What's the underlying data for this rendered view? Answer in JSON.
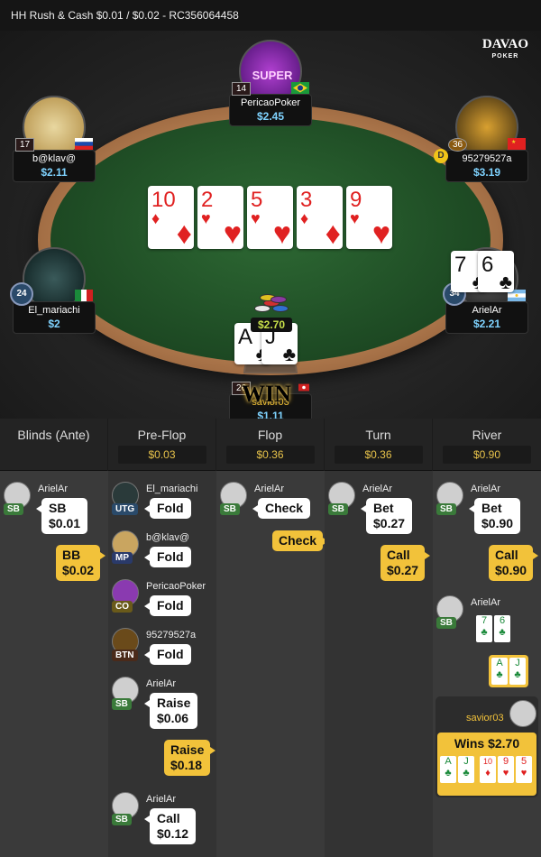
{
  "header": {
    "title": "HH  Rush & Cash $0.01 / $0.02  - RC356064458"
  },
  "logo": {
    "text": "DAVAO",
    "sub": "POKER"
  },
  "players": {
    "top": {
      "name": "PericaoPoker",
      "stack": "$2.45",
      "level": "14"
    },
    "top_left": {
      "name": "b@klav@",
      "stack": "$2.11",
      "level": "17"
    },
    "top_right": {
      "name": "95279527a",
      "stack": "$3.19",
      "level": "36",
      "dealer": "D"
    },
    "left": {
      "name": "El_mariachi",
      "stack": "$2",
      "level": "24"
    },
    "right": {
      "name": "ArielAr",
      "stack": "$2.21",
      "level": "34"
    },
    "bottom": {
      "name": "savior03",
      "stack": "$1.11",
      "level": "26"
    }
  },
  "board": [
    {
      "rank": "10",
      "suit": "♦"
    },
    {
      "rank": "2",
      "suit": "♥"
    },
    {
      "rank": "5",
      "suit": "♥"
    },
    {
      "rank": "3",
      "suit": "♦"
    },
    {
      "rank": "9",
      "suit": "♥"
    }
  ],
  "right_hole": [
    {
      "rank": "7",
      "suit": "♣"
    },
    {
      "rank": "6",
      "suit": "♣"
    }
  ],
  "bottom_hole": [
    {
      "rank": "A",
      "suit": "♣"
    },
    {
      "rank": "J",
      "suit": "♣"
    }
  ],
  "pot": "$2.70",
  "win_label": "WIN",
  "history": {
    "columns": [
      {
        "title": "Blinds (Ante)",
        "pot": ""
      },
      {
        "title": "Pre-Flop",
        "pot": "$0.03"
      },
      {
        "title": "Flop",
        "pot": "$0.36"
      },
      {
        "title": "Turn",
        "pot": "$0.36"
      },
      {
        "title": "River",
        "pot": "$0.90"
      }
    ],
    "blinds": {
      "sb_name": "ArielAr",
      "sb_pos": "SB",
      "sb_action": "SB",
      "sb_amount": "$0.01",
      "bb_action": "BB",
      "bb_amount": "$0.02"
    },
    "preflop": [
      {
        "name": "El_mariachi",
        "pos": "UTG",
        "action": "Fold"
      },
      {
        "name": "b@klav@",
        "pos": "MP",
        "action": "Fold"
      },
      {
        "name": "PericaoPoker",
        "pos": "CO",
        "action": "Fold"
      },
      {
        "name": "95279527a",
        "pos": "BTN",
        "action": "Fold"
      },
      {
        "name": "ArielAr",
        "pos": "SB",
        "action": "Raise",
        "amount": "$0.06"
      },
      {
        "hero": true,
        "action": "Raise",
        "amount": "$0.18"
      },
      {
        "name": "ArielAr",
        "pos": "SB",
        "action": "Call",
        "amount": "$0.12"
      }
    ],
    "flop": {
      "name": "ArielAr",
      "pos": "SB",
      "action": "Check",
      "hero_action": "Check"
    },
    "turn": {
      "name": "ArielAr",
      "pos": "SB",
      "action": "Bet",
      "amount": "$0.27",
      "hero_action": "Call",
      "hero_amount": "$0.27"
    },
    "river": {
      "name": "ArielAr",
      "pos": "SB",
      "action": "Bet",
      "amount": "$0.90",
      "hero_action": "Call",
      "hero_amount": "$0.90",
      "show_name": "ArielAr",
      "show_pos": "SB",
      "winner": "savior03",
      "wins": "Wins $2.70"
    }
  },
  "colors": {
    "accent": "#f2c23a",
    "stack": "#7fd3ff",
    "pot": "#c8e04a"
  }
}
